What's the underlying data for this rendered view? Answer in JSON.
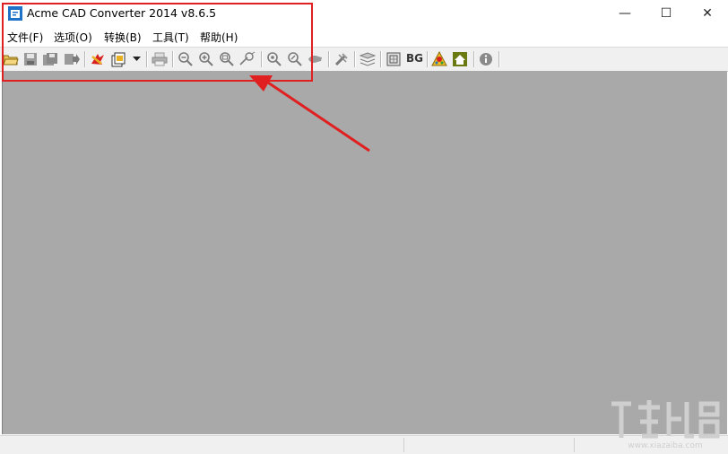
{
  "window": {
    "title": "Acme CAD Converter 2014 v8.6.5",
    "controls": {
      "minimize": "—",
      "maximize": "☐",
      "close": "✕"
    }
  },
  "menu": {
    "items": [
      {
        "label": "文件(F)"
      },
      {
        "label": "选项(O)"
      },
      {
        "label": "转换(B)"
      },
      {
        "label": "工具(T)"
      },
      {
        "label": "帮助(H)"
      }
    ]
  },
  "toolbar": {
    "bg_label": "BG",
    "icons": [
      "open-folder-icon",
      "save-icon",
      "save-all-icon",
      "export-icon",
      "convert-icon",
      "batch-convert-icon",
      "dropdown-arrow-icon",
      "print-icon",
      "zoom-out-icon",
      "zoom-in-icon",
      "zoom-window-icon",
      "zoom-pan-icon",
      "zoom-extent-icon",
      "zoom-realtime-icon",
      "pan-icon",
      "settings-icon",
      "layers-icon",
      "view-icon",
      "purchase-icon",
      "home-icon",
      "about-icon"
    ]
  },
  "colors": {
    "highlight": "#e02020",
    "canvas": "#a9a9a9"
  },
  "watermark": {
    "text": "www.xiazaiba.com"
  }
}
